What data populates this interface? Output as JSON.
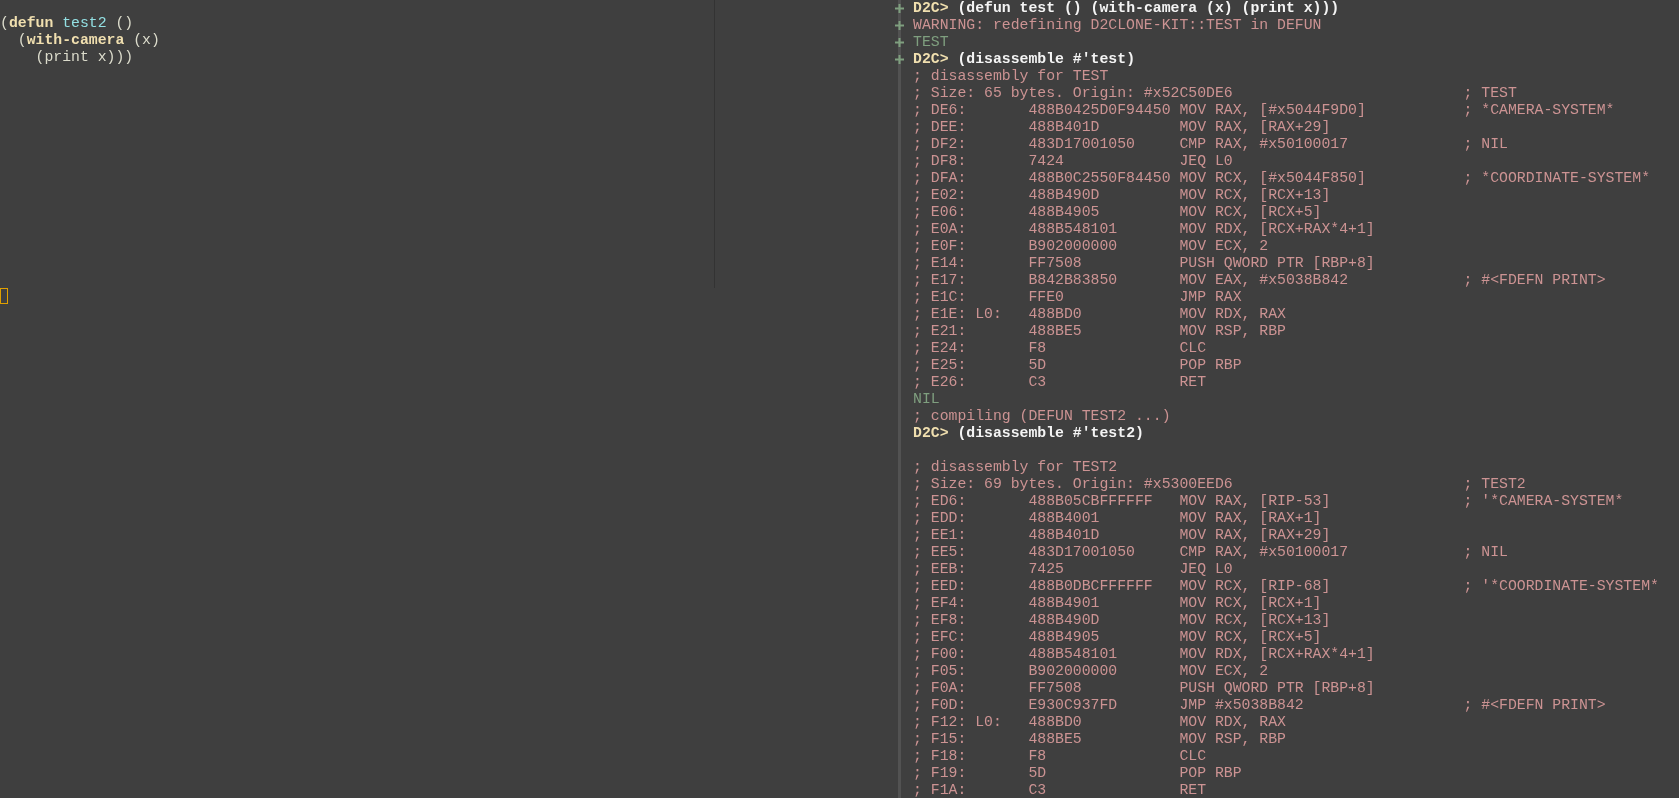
{
  "editor": {
    "lines": [
      {
        "segments": [
          {
            "kind": "plain",
            "text": "("
          },
          {
            "kind": "keyword",
            "text": "defun"
          },
          {
            "kind": "function",
            "text": " test2"
          },
          {
            "kind": "plain",
            "text": " ()"
          }
        ]
      },
      {
        "segments": [
          {
            "kind": "plain",
            "text": "  ("
          },
          {
            "kind": "keyword",
            "text": "with-camera"
          },
          {
            "kind": "plain",
            "text": " (x)"
          }
        ]
      },
      {
        "segments": [
          {
            "kind": "plain",
            "text": "    (print x)))"
          }
        ]
      }
    ]
  },
  "repl": {
    "lines": [
      {
        "kind": "input",
        "changed": true,
        "prompt": "D2C>",
        "text": "(defun test () (with-camera (x) (print x)))"
      },
      {
        "kind": "output",
        "changed": true,
        "text": "WARNING: redefining D2CLONE-KIT::TEST in DEFUN"
      },
      {
        "kind": "value",
        "changed": true,
        "text": "TEST"
      },
      {
        "kind": "input",
        "changed": true,
        "prompt": "D2C>",
        "text": "(disassemble #'test)"
      },
      {
        "kind": "output",
        "changed": false,
        "text": "; disassembly for TEST"
      },
      {
        "kind": "output",
        "changed": false,
        "text": "; Size: 65 bytes. Origin: #x52C50DE6                          ; TEST"
      },
      {
        "kind": "output",
        "changed": false,
        "text": "; DE6:       488B0425D0F94450 MOV RAX, [#x5044F9D0]           ; *CAMERA-SYSTEM*"
      },
      {
        "kind": "output",
        "changed": false,
        "text": "; DEE:       488B401D         MOV RAX, [RAX+29]"
      },
      {
        "kind": "output",
        "changed": false,
        "text": "; DF2:       483D17001050     CMP RAX, #x50100017             ; NIL"
      },
      {
        "kind": "output",
        "changed": false,
        "text": "; DF8:       7424             JEQ L0"
      },
      {
        "kind": "output",
        "changed": false,
        "text": "; DFA:       488B0C2550F84450 MOV RCX, [#x5044F850]           ; *COORDINATE-SYSTEM*"
      },
      {
        "kind": "output",
        "changed": false,
        "text": "; E02:       488B490D         MOV RCX, [RCX+13]"
      },
      {
        "kind": "output",
        "changed": false,
        "text": "; E06:       488B4905         MOV RCX, [RCX+5]"
      },
      {
        "kind": "output",
        "changed": false,
        "text": "; E0A:       488B548101       MOV RDX, [RCX+RAX*4+1]"
      },
      {
        "kind": "output",
        "changed": false,
        "text": "; E0F:       B902000000       MOV ECX, 2"
      },
      {
        "kind": "output",
        "changed": false,
        "text": "; E14:       FF7508           PUSH QWORD PTR [RBP+8]"
      },
      {
        "kind": "output",
        "changed": false,
        "text": "; E17:       B842B83850       MOV EAX, #x5038B842             ; #<FDEFN PRINT>"
      },
      {
        "kind": "output",
        "changed": false,
        "text": "; E1C:       FFE0             JMP RAX"
      },
      {
        "kind": "output",
        "changed": false,
        "text": "; E1E: L0:   488BD0           MOV RDX, RAX"
      },
      {
        "kind": "output",
        "changed": false,
        "text": "; E21:       488BE5           MOV RSP, RBP"
      },
      {
        "kind": "output",
        "changed": false,
        "text": "; E24:       F8               CLC"
      },
      {
        "kind": "output",
        "changed": false,
        "text": "; E25:       5D               POP RBP"
      },
      {
        "kind": "output",
        "changed": false,
        "text": "; E26:       C3               RET"
      },
      {
        "kind": "value",
        "changed": false,
        "text": "NIL"
      },
      {
        "kind": "output",
        "changed": false,
        "text": "; compiling (DEFUN TEST2 ...)"
      },
      {
        "kind": "input",
        "changed": false,
        "prompt": "D2C>",
        "text": "(disassemble #'test2)"
      },
      {
        "kind": "blank",
        "changed": false
      },
      {
        "kind": "output",
        "changed": false,
        "text": "; disassembly for TEST2"
      },
      {
        "kind": "output",
        "changed": false,
        "text": "; Size: 69 bytes. Origin: #x5300EED6                          ; TEST2"
      },
      {
        "kind": "output",
        "changed": false,
        "text": "; ED6:       488B05CBFFFFFF   MOV RAX, [RIP-53]               ; '*CAMERA-SYSTEM*"
      },
      {
        "kind": "output",
        "changed": false,
        "text": "; EDD:       488B4001         MOV RAX, [RAX+1]"
      },
      {
        "kind": "output",
        "changed": false,
        "text": "; EE1:       488B401D         MOV RAX, [RAX+29]"
      },
      {
        "kind": "output",
        "changed": false,
        "text": "; EE5:       483D17001050     CMP RAX, #x50100017             ; NIL"
      },
      {
        "kind": "output",
        "changed": false,
        "text": "; EEB:       7425             JEQ L0"
      },
      {
        "kind": "output",
        "changed": false,
        "text": "; EED:       488B0DBCFFFFFF   MOV RCX, [RIP-68]               ; '*COORDINATE-SYSTEM*"
      },
      {
        "kind": "output",
        "changed": false,
        "text": "; EF4:       488B4901         MOV RCX, [RCX+1]"
      },
      {
        "kind": "output",
        "changed": false,
        "text": "; EF8:       488B490D         MOV RCX, [RCX+13]"
      },
      {
        "kind": "output",
        "changed": false,
        "text": "; EFC:       488B4905         MOV RCX, [RCX+5]"
      },
      {
        "kind": "output",
        "changed": false,
        "text": "; F00:       488B548101       MOV RDX, [RCX+RAX*4+1]"
      },
      {
        "kind": "output",
        "changed": false,
        "text": "; F05:       B902000000       MOV ECX, 2"
      },
      {
        "kind": "output",
        "changed": false,
        "text": "; F0A:       FF7508           PUSH QWORD PTR [RBP+8]"
      },
      {
        "kind": "output",
        "changed": false,
        "text": "; F0D:       E930C937FD       JMP #x5038B842                  ; #<FDEFN PRINT>"
      },
      {
        "kind": "output",
        "changed": false,
        "text": "; F12: L0:   488BD0           MOV RDX, RAX"
      },
      {
        "kind": "output",
        "changed": false,
        "text": "; F15:       488BE5           MOV RSP, RBP"
      },
      {
        "kind": "output",
        "changed": false,
        "text": "; F18:       F8               CLC"
      },
      {
        "kind": "output",
        "changed": false,
        "text": "; F19:       5D               POP RBP"
      },
      {
        "kind": "output",
        "changed": false,
        "text": "; F1A:       C3               RET"
      }
    ]
  }
}
